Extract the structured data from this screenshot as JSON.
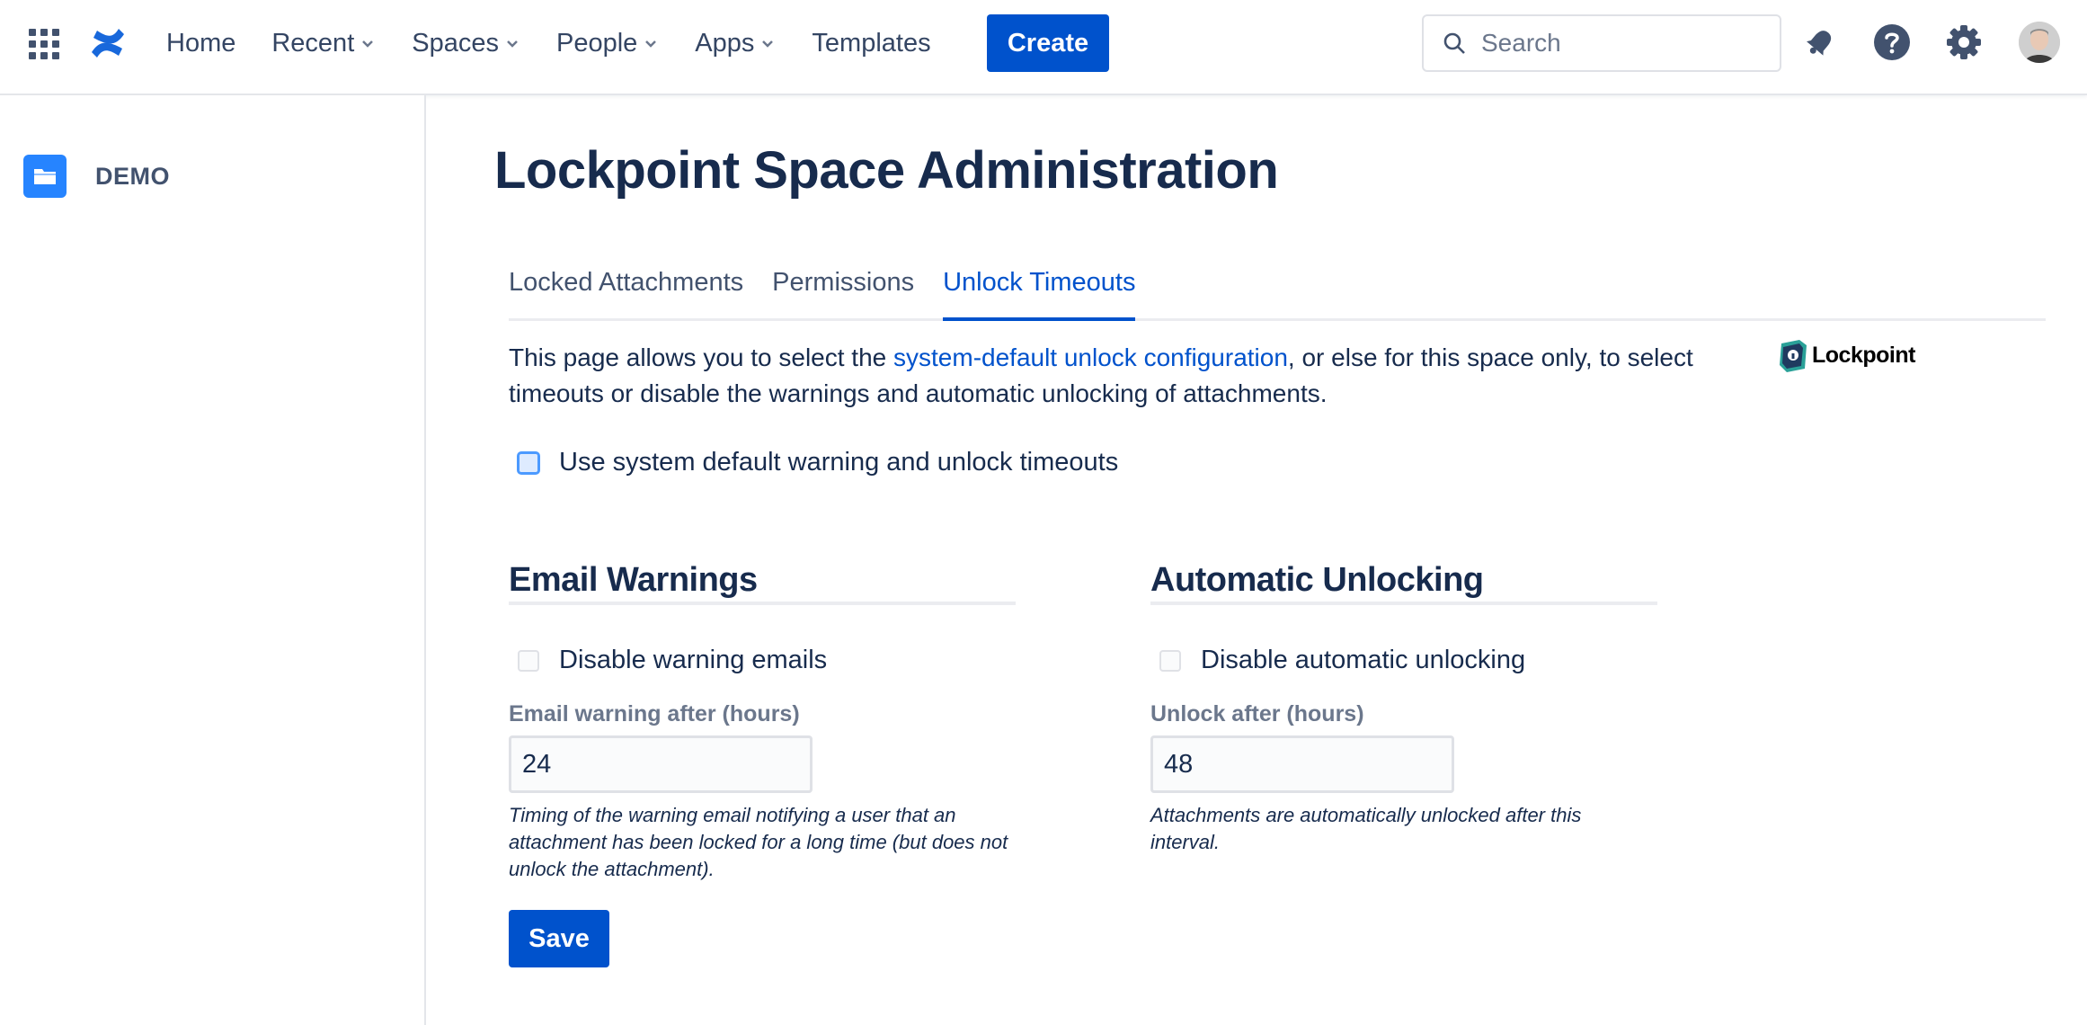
{
  "nav": {
    "items": [
      {
        "label": "Home",
        "has_chevron": false
      },
      {
        "label": "Recent",
        "has_chevron": true
      },
      {
        "label": "Spaces",
        "has_chevron": true
      },
      {
        "label": "People",
        "has_chevron": true
      },
      {
        "label": "Apps",
        "has_chevron": true
      },
      {
        "label": "Templates",
        "has_chevron": false
      }
    ],
    "create_label": "Create",
    "search_placeholder": "Search",
    "icons": [
      "app-switcher-icon",
      "confluence-logo-icon",
      "notification-bell-icon",
      "help-icon",
      "settings-gear-icon",
      "user-avatar"
    ]
  },
  "sidebar": {
    "space_name": "DEMO"
  },
  "main": {
    "title": "Lockpoint Space Administration",
    "tabs": [
      {
        "label": "Locked Attachments",
        "active": false
      },
      {
        "label": "Permissions",
        "active": false
      },
      {
        "label": "Unlock Timeouts",
        "active": true
      }
    ],
    "intro_before": "This page allows you to select the ",
    "intro_link": "system-default unlock configuration",
    "intro_after": ", or else for this space only, to select timeouts or disable the warnings and automatic unlocking of attachments.",
    "brand_name": "Lockpoint",
    "use_default_label": "Use system default warning and unlock timeouts",
    "email": {
      "title": "Email Warnings",
      "disable_label": "Disable warning emails",
      "field_label": "Email warning after (hours)",
      "value": "24",
      "help": "Timing of the warning email notifying a user that an attachment has been locked for a long time (but does not unlock the attachment)."
    },
    "auto": {
      "title": "Automatic Unlocking",
      "disable_label": "Disable automatic unlocking",
      "field_label": "Unlock after (hours)",
      "value": "48",
      "help": "Attachments are automatically unlocked after this interval."
    },
    "save_label": "Save"
  },
  "colors": {
    "accent": "#0052cc",
    "text": "#172b4d",
    "subtle": "#6b778c",
    "space_icon": "#2684ff"
  }
}
